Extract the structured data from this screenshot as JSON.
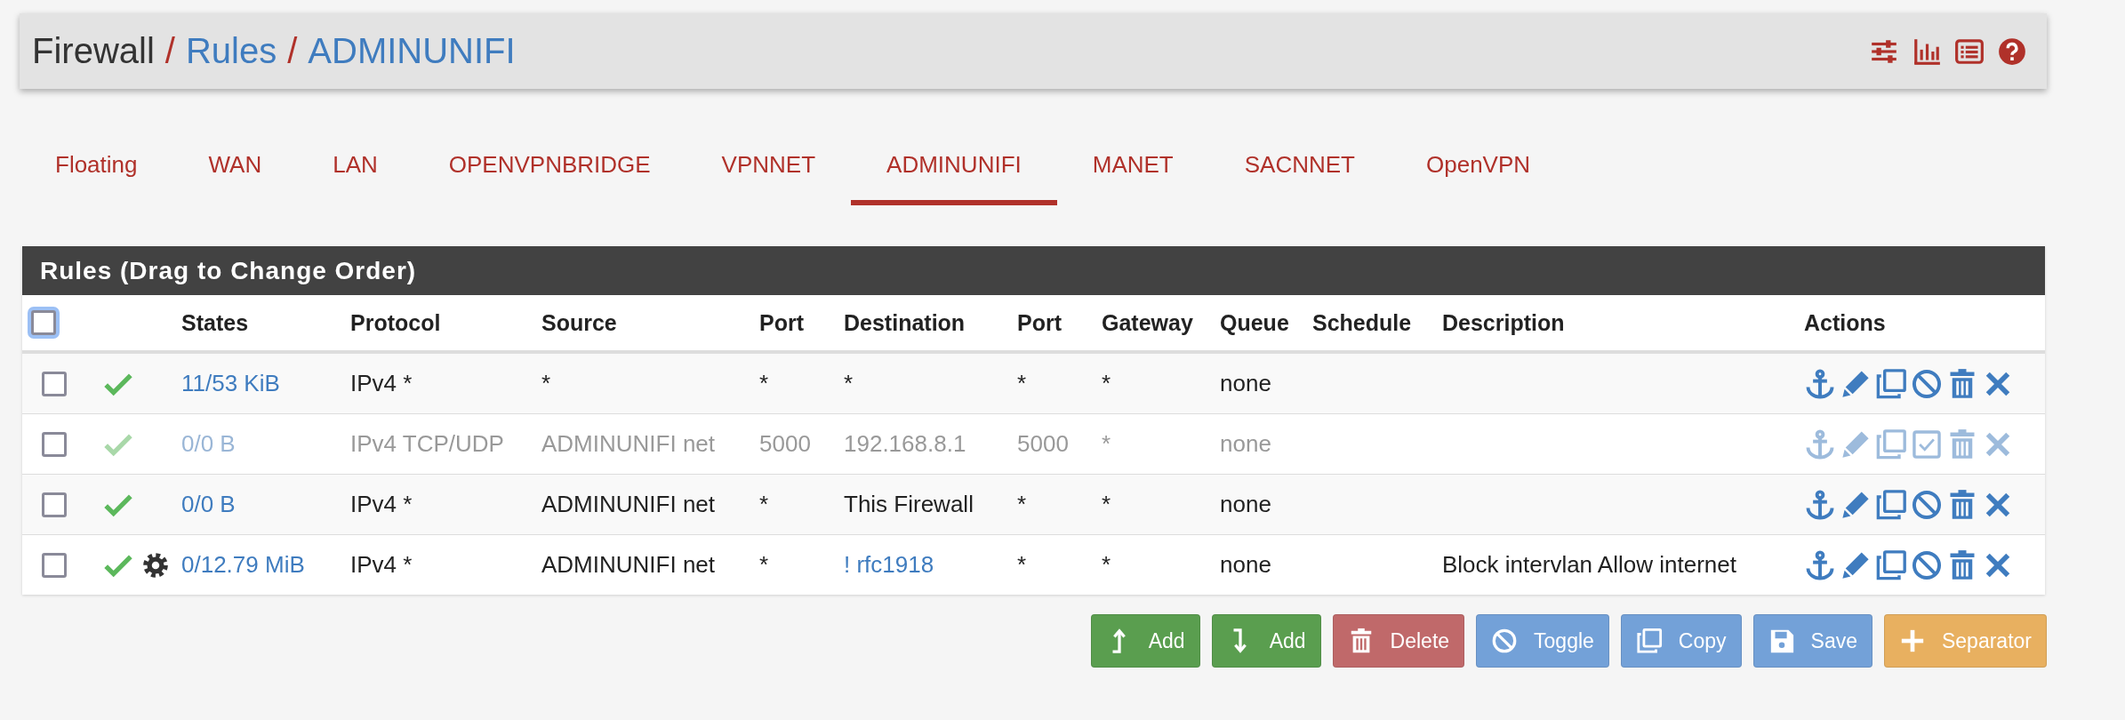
{
  "breadcrumb": [
    {
      "text": "Firewall",
      "kind": "plain"
    },
    {
      "text": "/",
      "kind": "separator"
    },
    {
      "text": "Rules",
      "kind": "link"
    },
    {
      "text": "/",
      "kind": "separator"
    },
    {
      "text": "ADMINUNIFI",
      "kind": "link"
    }
  ],
  "tabs": [
    {
      "label": "Floating",
      "selected": false
    },
    {
      "label": "WAN",
      "selected": false
    },
    {
      "label": "LAN",
      "selected": false
    },
    {
      "label": "OPENVPNBRIDGE",
      "selected": false
    },
    {
      "label": "VPNNET",
      "selected": false
    },
    {
      "label": "ADMINUNIFI",
      "selected": true
    },
    {
      "label": "MANET",
      "selected": false
    },
    {
      "label": "SACNNET",
      "selected": false
    },
    {
      "label": "OpenVPN",
      "selected": false
    }
  ],
  "table": {
    "title": "Rules (Drag to Change Order)",
    "select_all": {
      "checked": false
    },
    "columns": [
      "States",
      "Protocol",
      "Source",
      "Port",
      "Destination",
      "Port",
      "Gateway",
      "Queue",
      "Schedule",
      "Description",
      "Actions"
    ],
    "rows": [
      {
        "checked": false,
        "disabled": false,
        "advanced": false,
        "states": "11/53 KiB",
        "protocol": "IPv4 *",
        "source": "*",
        "source_port": "*",
        "destination": "*",
        "destination_link": false,
        "destination_port": "*",
        "gateway": "*",
        "queue": "none"
      },
      {
        "checked": false,
        "disabled": true,
        "advanced": false,
        "states": "0/0 B",
        "protocol": "IPv4 TCP/UDP",
        "source": "ADMINUNIFI net",
        "source_port": "5000",
        "destination": "192.168.8.1",
        "destination_link": false,
        "destination_port": "5000",
        "gateway": "*",
        "queue": "none"
      },
      {
        "checked": false,
        "disabled": false,
        "advanced": false,
        "states": "0/0 B",
        "protocol": "IPv4 *",
        "source": "ADMINUNIFI net",
        "source_port": "*",
        "destination": "This Firewall",
        "destination_link": false,
        "destination_port": "*",
        "gateway": "*",
        "queue": "none"
      },
      {
        "checked": false,
        "disabled": false,
        "advanced": true,
        "states": "0/12.79 MiB",
        "protocol": "IPv4 *",
        "source": "ADMINUNIFI net",
        "source_port": "*",
        "destination": "! rfc1918",
        "destination_link": true,
        "destination_port": "*",
        "gateway": "*",
        "queue": "none",
        "description": "Block intervlan Allow internet"
      }
    ]
  },
  "buttons": [
    {
      "label": "Add",
      "kind": "add_top"
    },
    {
      "label": "Add",
      "kind": "add_bottom"
    },
    {
      "label": "Delete",
      "kind": "delete"
    },
    {
      "label": "Toggle",
      "kind": "toggle"
    },
    {
      "label": "Copy",
      "kind": "copy"
    },
    {
      "label": "Save",
      "kind": "save"
    },
    {
      "label": "Separator",
      "kind": "separator"
    }
  ]
}
